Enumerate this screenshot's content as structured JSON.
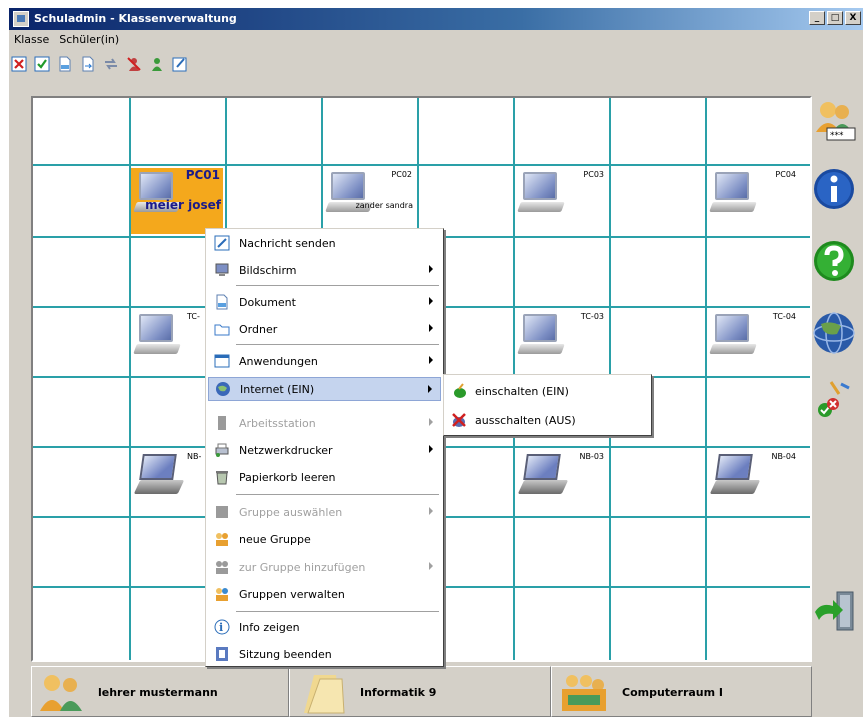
{
  "window": {
    "title": "Schuladmin - Klassenverwaltung",
    "controls": [
      "_",
      "□",
      "X"
    ]
  },
  "menubar": [
    "Klasse",
    "Schüler(in)"
  ],
  "toolbar": [
    "close-red-icon",
    "check-green-icon",
    "document-icon",
    "document-send-icon",
    "transfer-icon",
    "user-remove-icon",
    "user-add-icon",
    "edit-icon"
  ],
  "room": {
    "workstations": [
      {
        "id": "pc01",
        "label": "PC01",
        "user": "meier josef",
        "type": "desktop",
        "selected": true
      },
      {
        "id": "pc02",
        "label": "PC02",
        "user": "zander sandra",
        "type": "desktop",
        "selected": false
      },
      {
        "id": "pc03",
        "label": "PC03",
        "user": "",
        "type": "desktop",
        "selected": false
      },
      {
        "id": "pc04",
        "label": "PC04",
        "user": "",
        "type": "desktop",
        "selected": false
      },
      {
        "id": "tc01",
        "label": "TC-",
        "user": "",
        "type": "desktop",
        "selected": false
      },
      {
        "id": "tc03",
        "label": "TC-03",
        "user": "",
        "type": "desktop",
        "selected": false
      },
      {
        "id": "tc04",
        "label": "TC-04",
        "user": "",
        "type": "desktop",
        "selected": false
      },
      {
        "id": "nb01",
        "label": "NB-",
        "user": "",
        "type": "laptop",
        "selected": false
      },
      {
        "id": "nb03",
        "label": "NB-03",
        "user": "",
        "type": "laptop",
        "selected": false
      },
      {
        "id": "nb04",
        "label": "NB-04",
        "user": "",
        "type": "laptop",
        "selected": false
      }
    ]
  },
  "context_menu": {
    "items": [
      {
        "label": "Nachricht senden",
        "icon": "message-icon",
        "submenu": false,
        "disabled": false
      },
      {
        "label": "Bildschirm",
        "icon": "screen-icon",
        "submenu": true,
        "disabled": false
      },
      {
        "label": "Dokument",
        "icon": "document-icon",
        "submenu": true,
        "disabled": false
      },
      {
        "label": "Ordner",
        "icon": "folder-icon",
        "submenu": true,
        "disabled": false
      },
      {
        "label": "Anwendungen",
        "icon": "application-icon",
        "submenu": true,
        "disabled": false
      },
      {
        "label": "Internet (EIN)",
        "icon": "globe-icon",
        "submenu": true,
        "disabled": false,
        "highlighted": true
      },
      {
        "label": "Arbeitsstation",
        "icon": "workstation-icon",
        "submenu": true,
        "disabled": true
      },
      {
        "label": "Netzwerkdrucker",
        "icon": "printer-icon",
        "submenu": true,
        "disabled": false
      },
      {
        "label": "Papierkorb leeren",
        "icon": "trash-icon",
        "submenu": false,
        "disabled": false
      },
      {
        "label": "Gruppe auswählen",
        "icon": "group-select-icon",
        "submenu": true,
        "disabled": true
      },
      {
        "label": "neue Gruppe",
        "icon": "new-group-icon",
        "submenu": false,
        "disabled": false
      },
      {
        "label": "zur Gruppe hinzufügen",
        "icon": "group-add-icon",
        "submenu": true,
        "disabled": true
      },
      {
        "label": "Gruppen verwalten",
        "icon": "group-manage-icon",
        "submenu": false,
        "disabled": false
      },
      {
        "label": "Info zeigen",
        "icon": "info-icon",
        "submenu": false,
        "disabled": false
      },
      {
        "label": "Sitzung beenden",
        "icon": "logout-icon",
        "submenu": false,
        "disabled": false
      }
    ]
  },
  "internet_submenu": [
    {
      "label": "einschalten (EIN)",
      "icon": "internet-on-icon"
    },
    {
      "label": "ausschalten (AUS)",
      "icon": "internet-off-icon"
    }
  ],
  "sidebar": [
    "users-password-icon",
    "info-icon",
    "help-icon",
    "globe-icon",
    "connection-status-icon",
    "exit-icon"
  ],
  "status": {
    "teacher": "lehrer mustermann",
    "class": "Informatik 9",
    "room": "Computerraum I"
  },
  "colors": {
    "grid": "#2aa0a8",
    "selected": "#f4a81c",
    "menu_highlight": "#c5d4ee",
    "titlebar": "#0a246a"
  }
}
